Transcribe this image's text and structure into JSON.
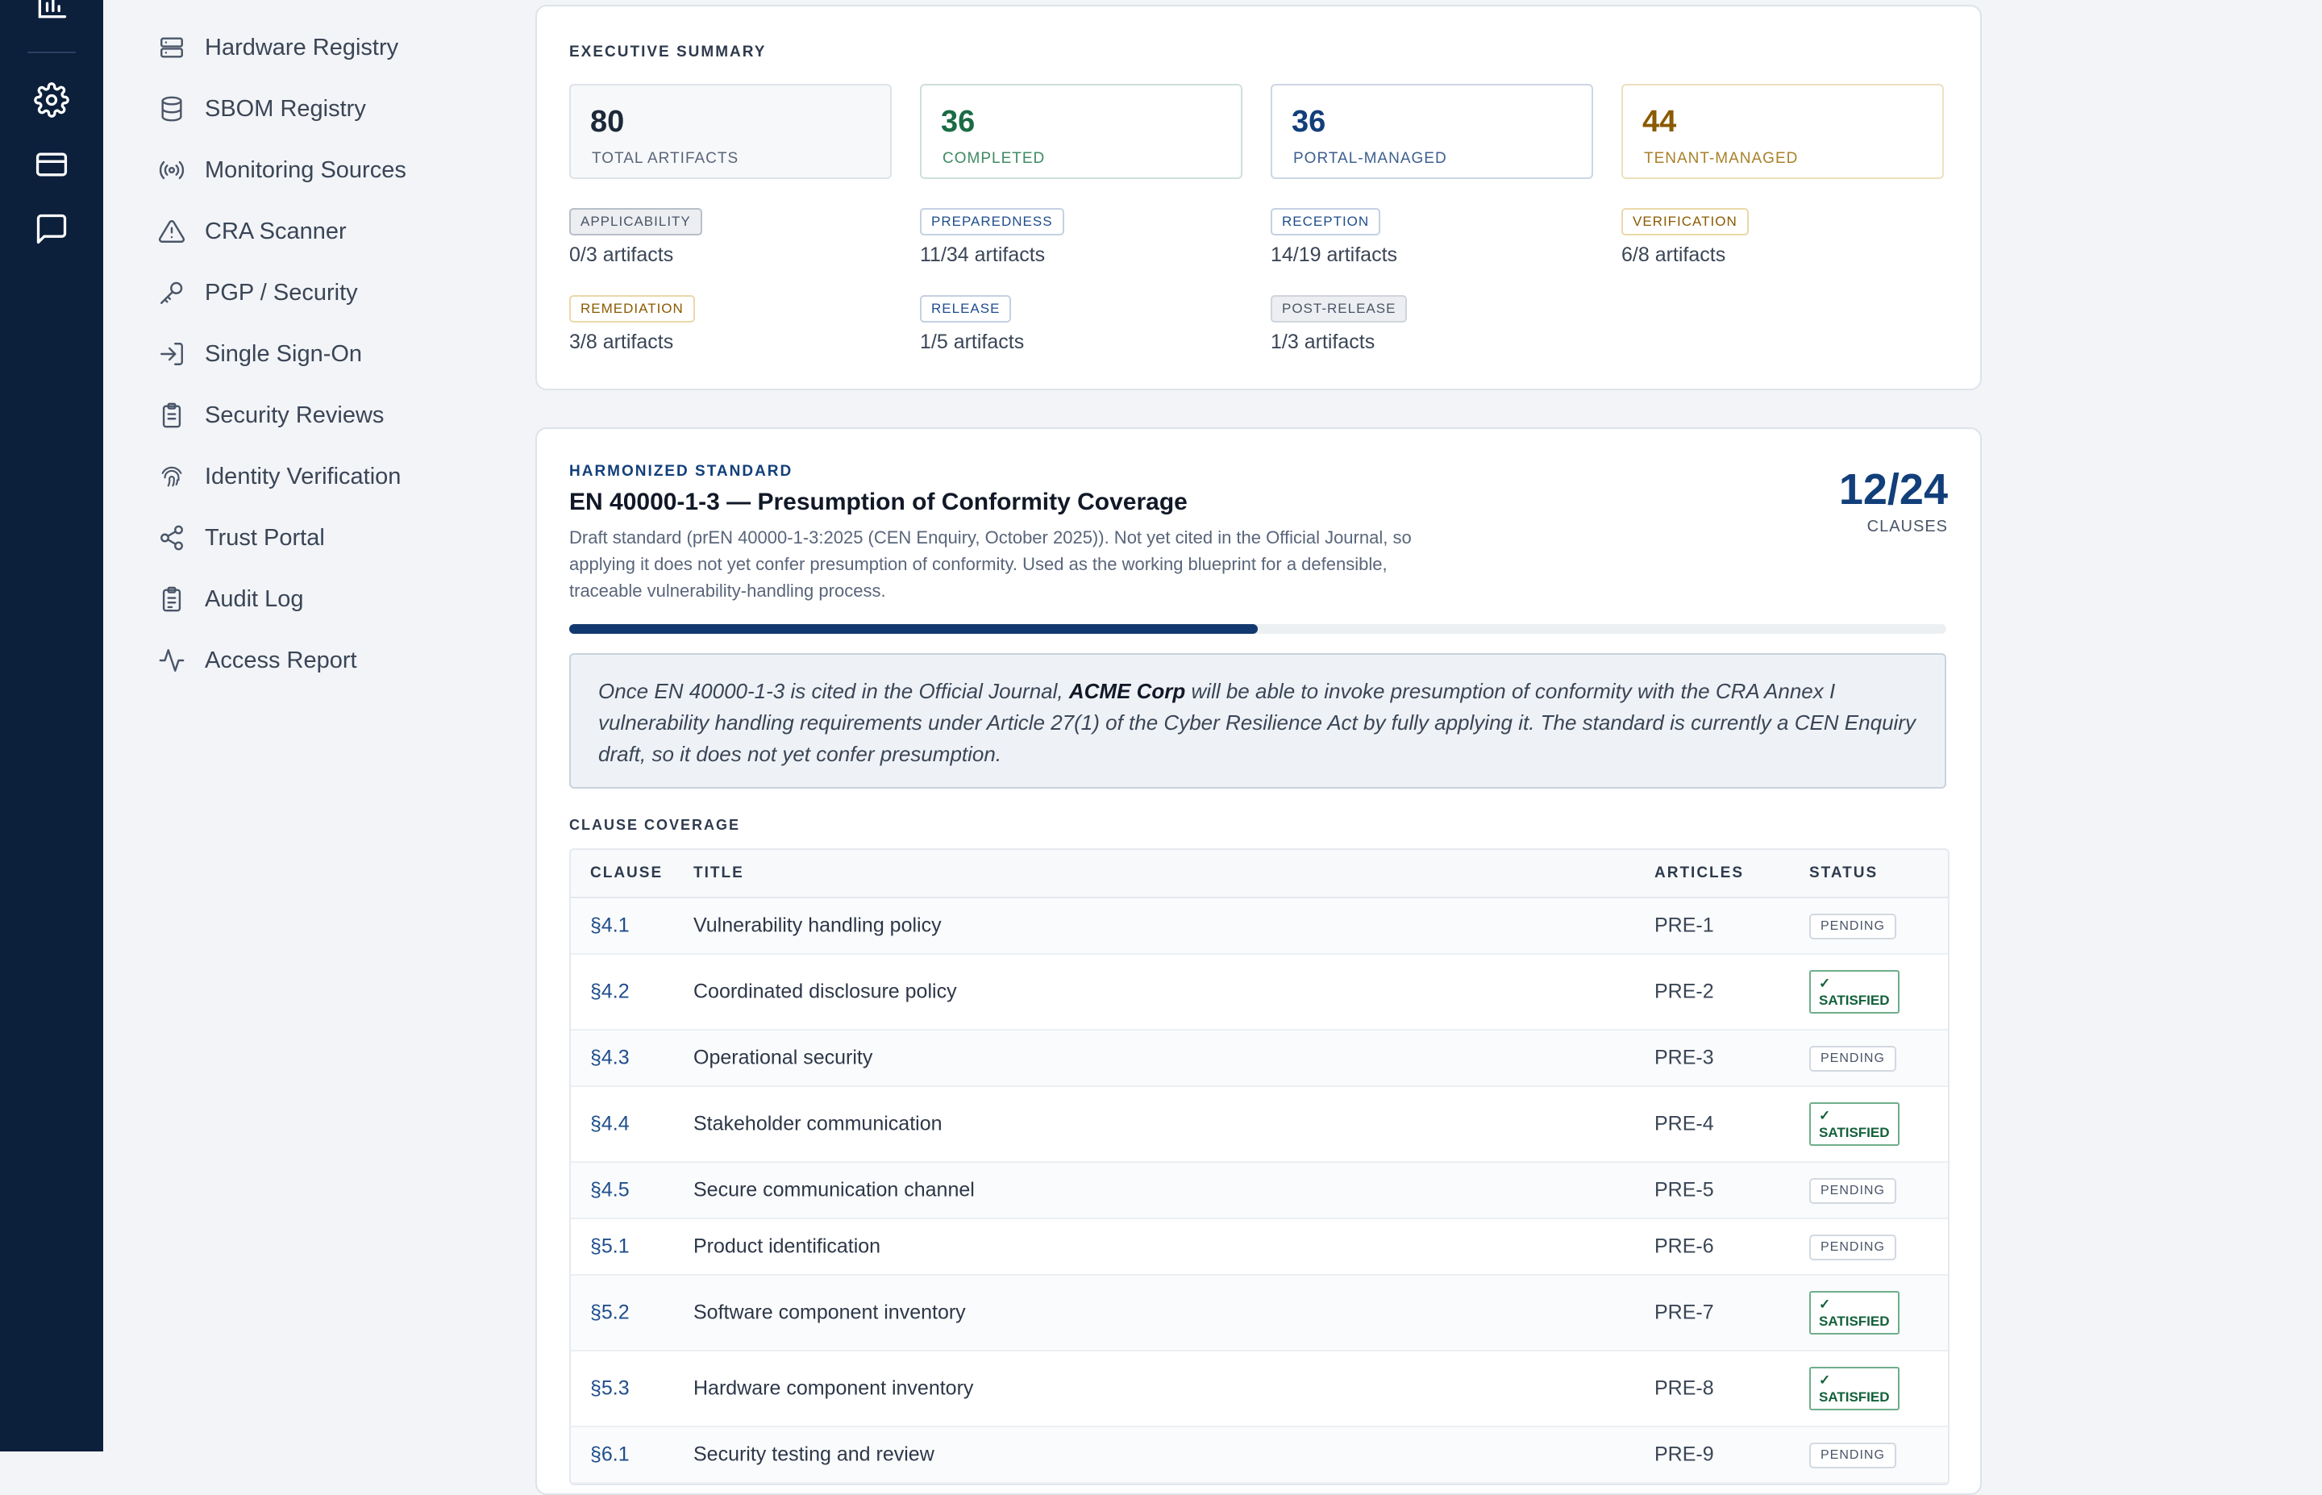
{
  "nav": {
    "items": [
      {
        "label": "Hardware Registry",
        "icon": "server-icon"
      },
      {
        "label": "SBOM Registry",
        "icon": "database-icon"
      },
      {
        "label": "Monitoring Sources",
        "icon": "broadcast-icon"
      },
      {
        "label": "CRA Scanner",
        "icon": "warning-triangle-icon"
      },
      {
        "label": "PGP / Security",
        "icon": "key-icon"
      },
      {
        "label": "Single Sign-On",
        "icon": "login-icon"
      },
      {
        "label": "Security Reviews",
        "icon": "clipboard-icon"
      },
      {
        "label": "Identity Verification",
        "icon": "fingerprint-icon"
      },
      {
        "label": "Trust Portal",
        "icon": "share-icon"
      },
      {
        "label": "Audit Log",
        "icon": "clipboard-list-icon"
      },
      {
        "label": "Access Report",
        "icon": "activity-icon"
      }
    ]
  },
  "summary": {
    "heading": "EXECUTIVE SUMMARY",
    "metrics": [
      {
        "value": "80",
        "label": "TOTAL ARTIFACTS",
        "color": "#1d2939"
      },
      {
        "value": "36",
        "label": "COMPLETED",
        "color": "#1b6b45"
      },
      {
        "value": "36",
        "label": "PORTAL-MANAGED",
        "color": "#123f7a"
      },
      {
        "value": "44",
        "label": "TENANT-MANAGED",
        "color": "#8a5a00"
      }
    ],
    "phases": [
      {
        "label": "APPLICABILITY",
        "count": "0/3 artifacts"
      },
      {
        "label": "PREPAREDNESS",
        "count": "11/34 artifacts"
      },
      {
        "label": "RECEPTION",
        "count": "14/19 artifacts"
      },
      {
        "label": "VERIFICATION",
        "count": "6/8 artifacts"
      },
      {
        "label": "REMEDIATION",
        "count": "3/8 artifacts"
      },
      {
        "label": "RELEASE",
        "count": "1/5 artifacts"
      },
      {
        "label": "POST-RELEASE",
        "count": "1/3 artifacts"
      }
    ]
  },
  "standard": {
    "eyebrow": "HARMONIZED STANDARD",
    "title": "EN 40000-1-3 — Presumption of Conformity Coverage",
    "description": "Draft standard (prEN 40000-1-3:2025 (CEN Enquiry, October 2025)). Not yet cited in the Official Journal, so applying it does not yet confer presumption of conformity. Used as the working blueprint for a defensible, traceable vulnerability-handling process.",
    "score": "12/24",
    "score_label": "CLAUSES",
    "progress": 0.5,
    "callout_pre": "Once EN 40000-1-3 is cited in the Official Journal, ",
    "callout_org": "ACME Corp",
    "callout_post": " will be able to invoke presumption of conformity with the CRA Annex I vulnerability handling requirements under Article 27(1) of the Cyber Resilience Act by fully applying it. The standard is currently a CEN Enquiry draft, so it does not yet confer presumption.",
    "coverage_heading": "CLAUSE COVERAGE",
    "columns": {
      "clause": "CLAUSE",
      "title": "TITLE",
      "articles": "ARTICLES",
      "status": "STATUS"
    },
    "status_labels": {
      "pending": "PENDING",
      "satisfied": "SATISFIED",
      "check": "✓"
    },
    "rows": [
      {
        "clause": "§4.1",
        "title": "Vulnerability handling policy",
        "article": "PRE-1",
        "status": "pending"
      },
      {
        "clause": "§4.2",
        "title": "Coordinated disclosure policy",
        "article": "PRE-2",
        "status": "satisfied"
      },
      {
        "clause": "§4.3",
        "title": "Operational security",
        "article": "PRE-3",
        "status": "pending"
      },
      {
        "clause": "§4.4",
        "title": "Stakeholder communication",
        "article": "PRE-4",
        "status": "satisfied"
      },
      {
        "clause": "§4.5",
        "title": "Secure communication channel",
        "article": "PRE-5",
        "status": "pending"
      },
      {
        "clause": "§5.1",
        "title": "Product identification",
        "article": "PRE-6",
        "status": "pending"
      },
      {
        "clause": "§5.2",
        "title": "Software component inventory",
        "article": "PRE-7",
        "status": "satisfied"
      },
      {
        "clause": "§5.3",
        "title": "Hardware component inventory",
        "article": "PRE-8",
        "status": "satisfied"
      },
      {
        "clause": "§6.1",
        "title": "Security testing and review",
        "article": "PRE-9",
        "status": "pending"
      }
    ]
  }
}
